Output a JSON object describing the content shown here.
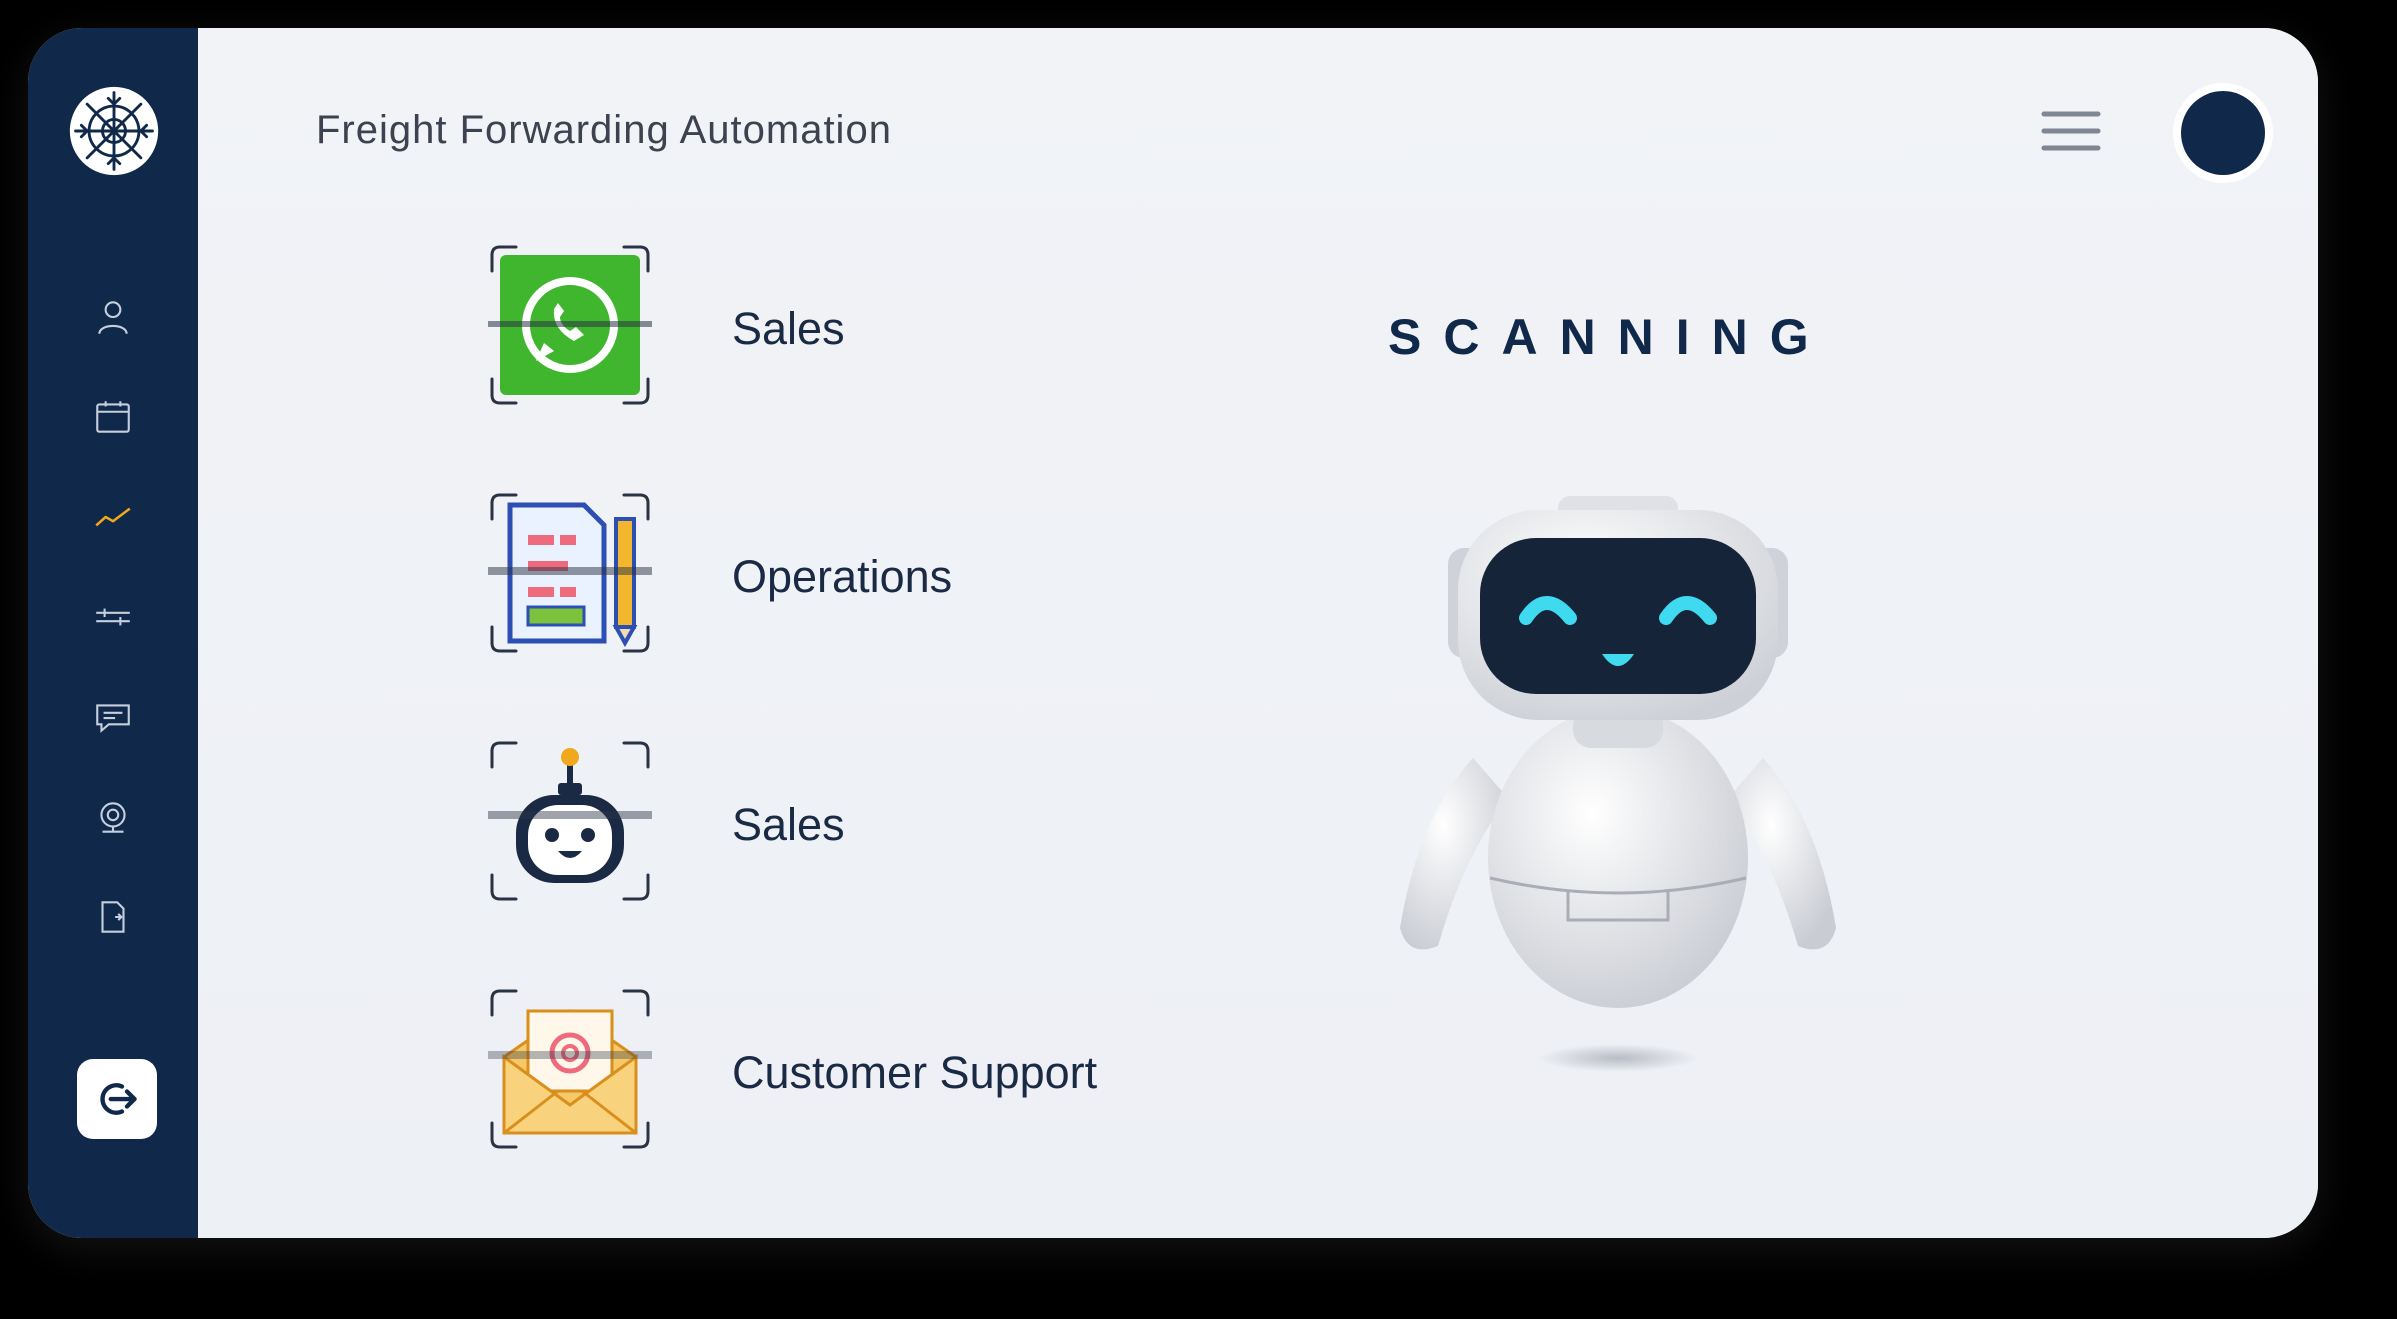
{
  "header": {
    "title": "Freight Forwarding Automation"
  },
  "sidebar": {
    "logo_icon": "snowflake-gear-logo",
    "items": [
      {
        "icon": "user-icon",
        "active": false
      },
      {
        "icon": "calendar-icon",
        "active": false
      },
      {
        "icon": "trend-chart-icon",
        "active": true
      },
      {
        "icon": "sliders-icon",
        "active": false
      },
      {
        "icon": "chat-icon",
        "active": false
      },
      {
        "icon": "robot-head-icon",
        "active": false
      },
      {
        "icon": "document-exit-icon",
        "active": false
      }
    ],
    "logout_icon": "logout-icon"
  },
  "automations": [
    {
      "label": "Sales",
      "icon": "whatsapp-icon"
    },
    {
      "label": "Operations",
      "icon": "document-pencil-icon"
    },
    {
      "label": "Sales",
      "icon": "chatbot-icon"
    },
    {
      "label": "Customer Support",
      "icon": "email-icon"
    }
  ],
  "status": {
    "text": "SCANNING"
  },
  "colors": {
    "sidebar": "#10294a",
    "active_nav": "#f0a81c",
    "background": "#eef0f5",
    "accent_cyan": "#3fd9f0"
  }
}
